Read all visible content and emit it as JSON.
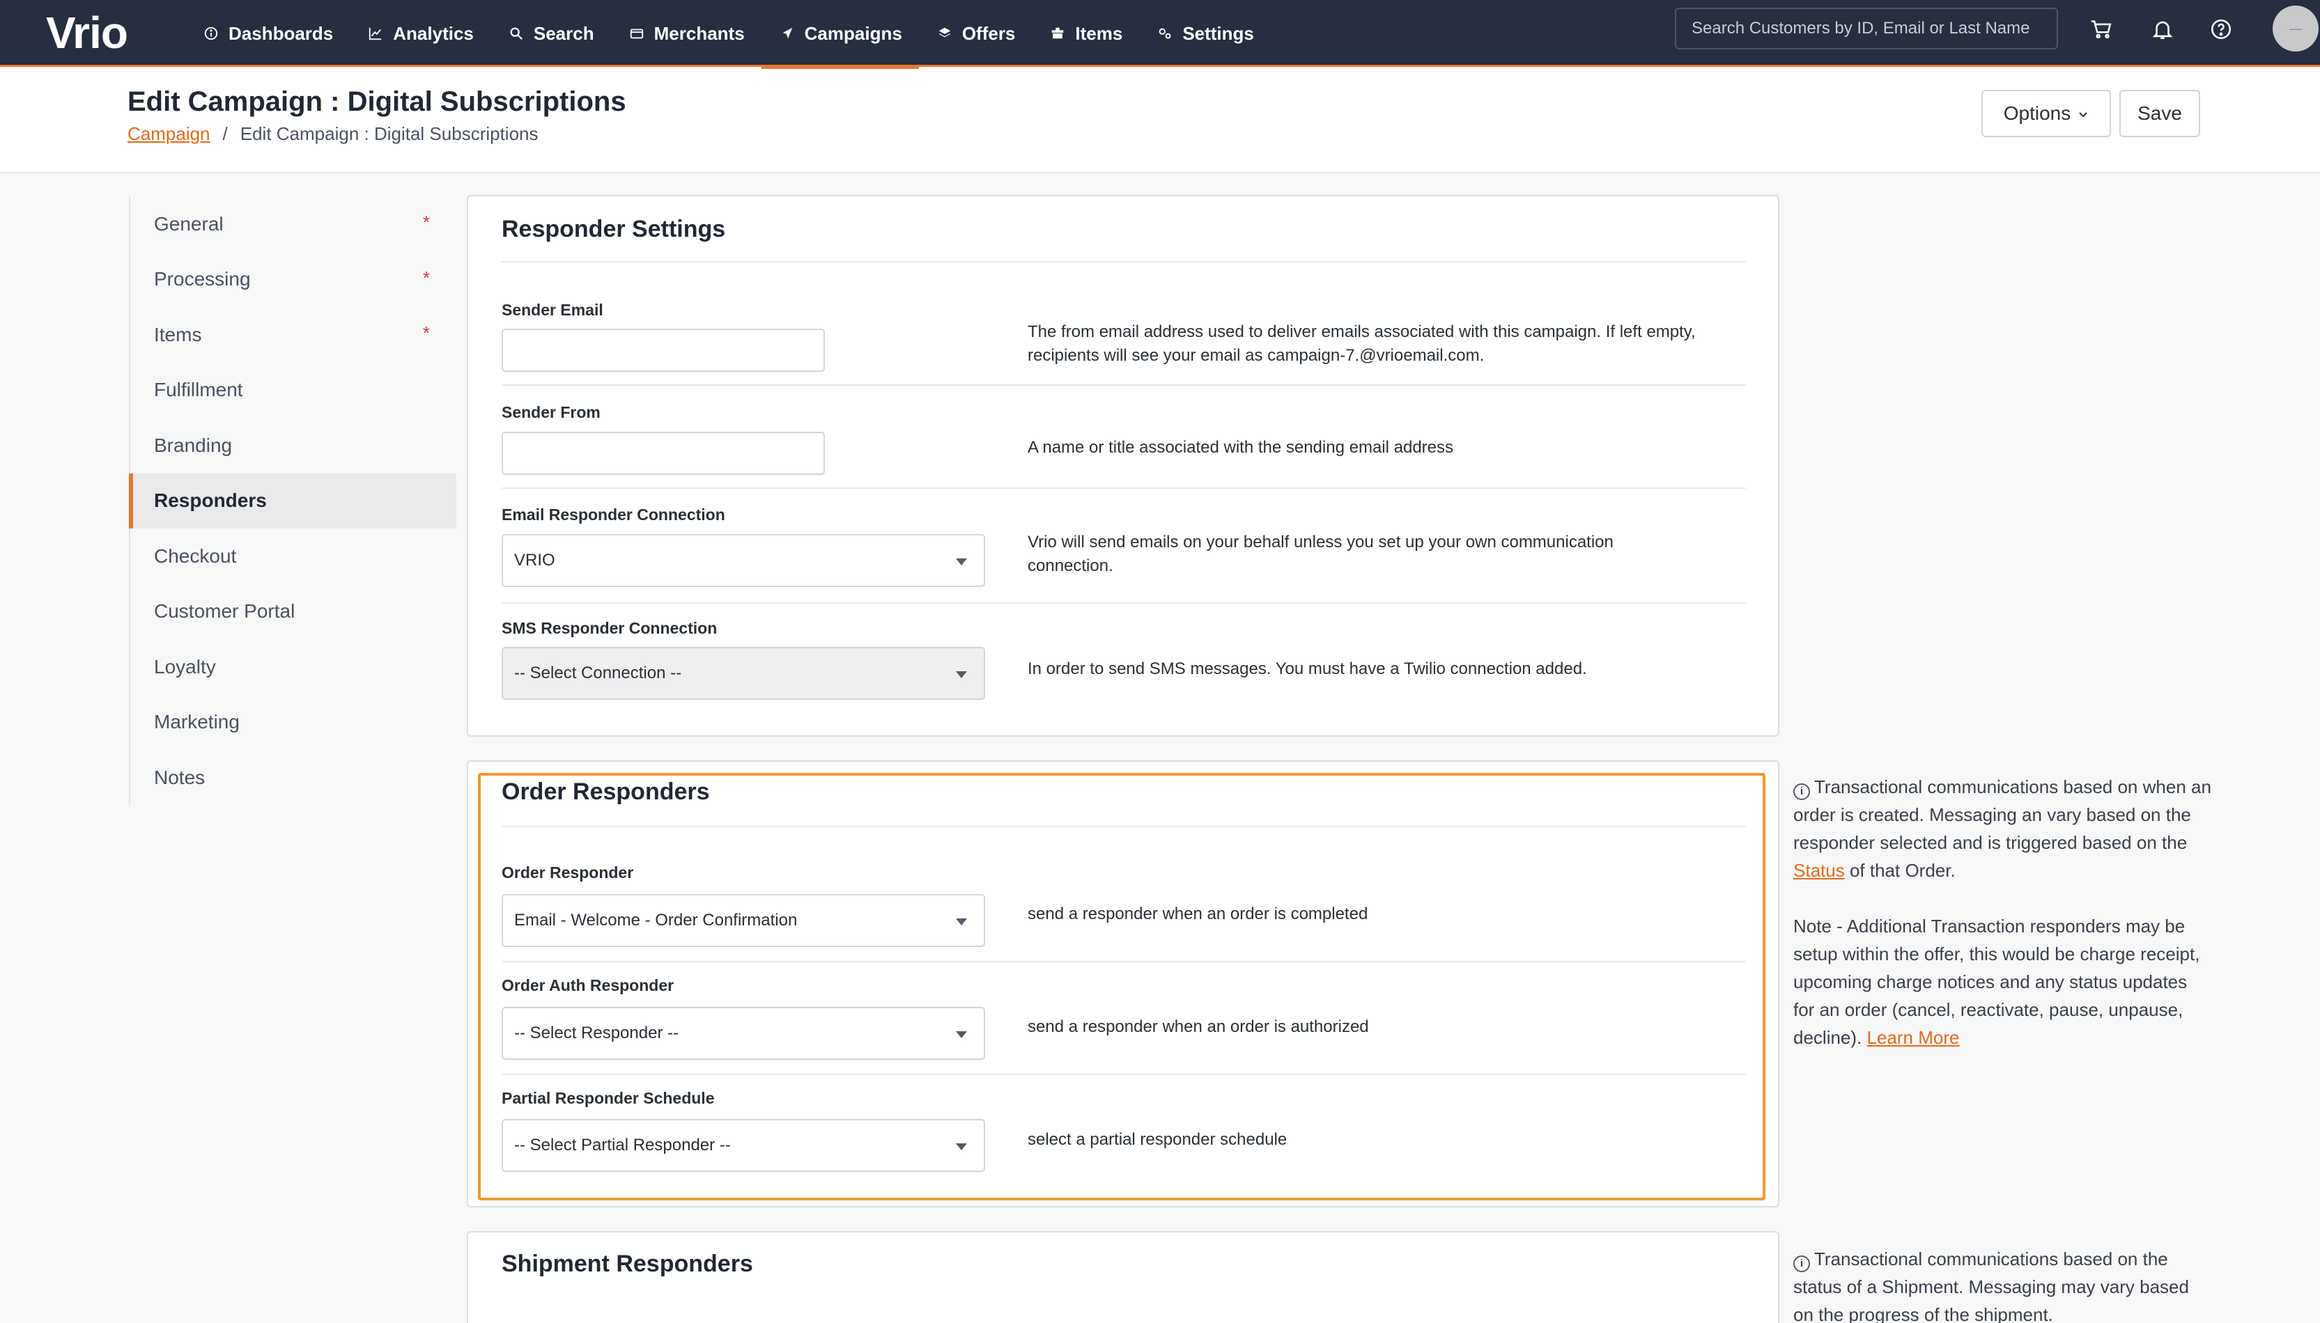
{
  "app": {
    "logo_text": "Vrio"
  },
  "nav": {
    "items": [
      {
        "label": "Dashboards",
        "icon": "info-icon"
      },
      {
        "label": "Analytics",
        "icon": "chart-icon"
      },
      {
        "label": "Search",
        "icon": "search-icon"
      },
      {
        "label": "Merchants",
        "icon": "card-icon"
      },
      {
        "label": "Campaigns",
        "icon": "send-icon",
        "active": true
      },
      {
        "label": "Offers",
        "icon": "layers-icon"
      },
      {
        "label": "Items",
        "icon": "box-icon"
      },
      {
        "label": "Settings",
        "icon": "gears-icon"
      }
    ],
    "search_placeholder": "Search Customers by ID, Email or Last Name",
    "avatar_text": "—"
  },
  "header": {
    "title": "Edit Campaign : Digital Subscriptions",
    "breadcrumb_root": "Campaign",
    "breadcrumb_sep": "/",
    "breadcrumb_current": "Edit Campaign : Digital Subscriptions",
    "options_label": "Options",
    "save_label": "Save"
  },
  "sidebar": {
    "items": [
      {
        "label": "General",
        "required": "*"
      },
      {
        "label": "Processing",
        "required": "*"
      },
      {
        "label": "Items",
        "required": "*"
      },
      {
        "label": "Fulfillment"
      },
      {
        "label": "Branding"
      },
      {
        "label": "Responders",
        "active": true
      },
      {
        "label": "Checkout"
      },
      {
        "label": "Customer Portal"
      },
      {
        "label": "Loyalty"
      },
      {
        "label": "Marketing"
      },
      {
        "label": "Notes"
      }
    ]
  },
  "responder_settings": {
    "title": "Responder Settings",
    "sender_email": {
      "label": "Sender Email",
      "value": "",
      "help": "The from email address used to deliver emails associated with this campaign. If left empty, recipients will see your email as campaign-7.@vrioemail.com."
    },
    "sender_from": {
      "label": "Sender From",
      "value": "",
      "help": "A name or title associated with the sending email address"
    },
    "email_connection": {
      "label": "Email Responder Connection",
      "value": "VRIO",
      "help": "Vrio will send emails on your behalf unless you set up your own communication connection."
    },
    "sms_connection": {
      "label": "SMS Responder Connection",
      "value": "-- Select Connection --",
      "help": "In order to send SMS messages. You must have a Twilio connection added."
    }
  },
  "order_responders": {
    "title": "Order Responders",
    "order_responder": {
      "label": "Order Responder",
      "value": "Email - Welcome - Order Confirmation",
      "help": "send a responder when an order is completed"
    },
    "order_auth_responder": {
      "label": "Order Auth Responder",
      "value": "-- Select Responder --",
      "help": "send a responder when an order is authorized"
    },
    "partial_schedule": {
      "label": "Partial Responder Schedule",
      "value": "-- Select Partial Responder --",
      "help": "select a partial responder schedule"
    },
    "aside_p1_a": "Transactional communications based on when an order is created. Messaging an vary based on the responder selected and is triggered based on the",
    "aside_p1_link": "Status",
    "aside_p1_b": "of that Order.",
    "aside_p2": "Note - Additional Transaction responders may be setup within the offer, this would be charge receipt, upcoming charge notices and any status updates for an order (cancel, reactivate, pause, unpause, decline).",
    "aside_p2_link": "Learn More"
  },
  "shipment_responders": {
    "title": "Shipment Responders",
    "aside_p1": "Transactional communications based on the status of a Shipment. Messaging may vary based on the progress of the shipment."
  }
}
